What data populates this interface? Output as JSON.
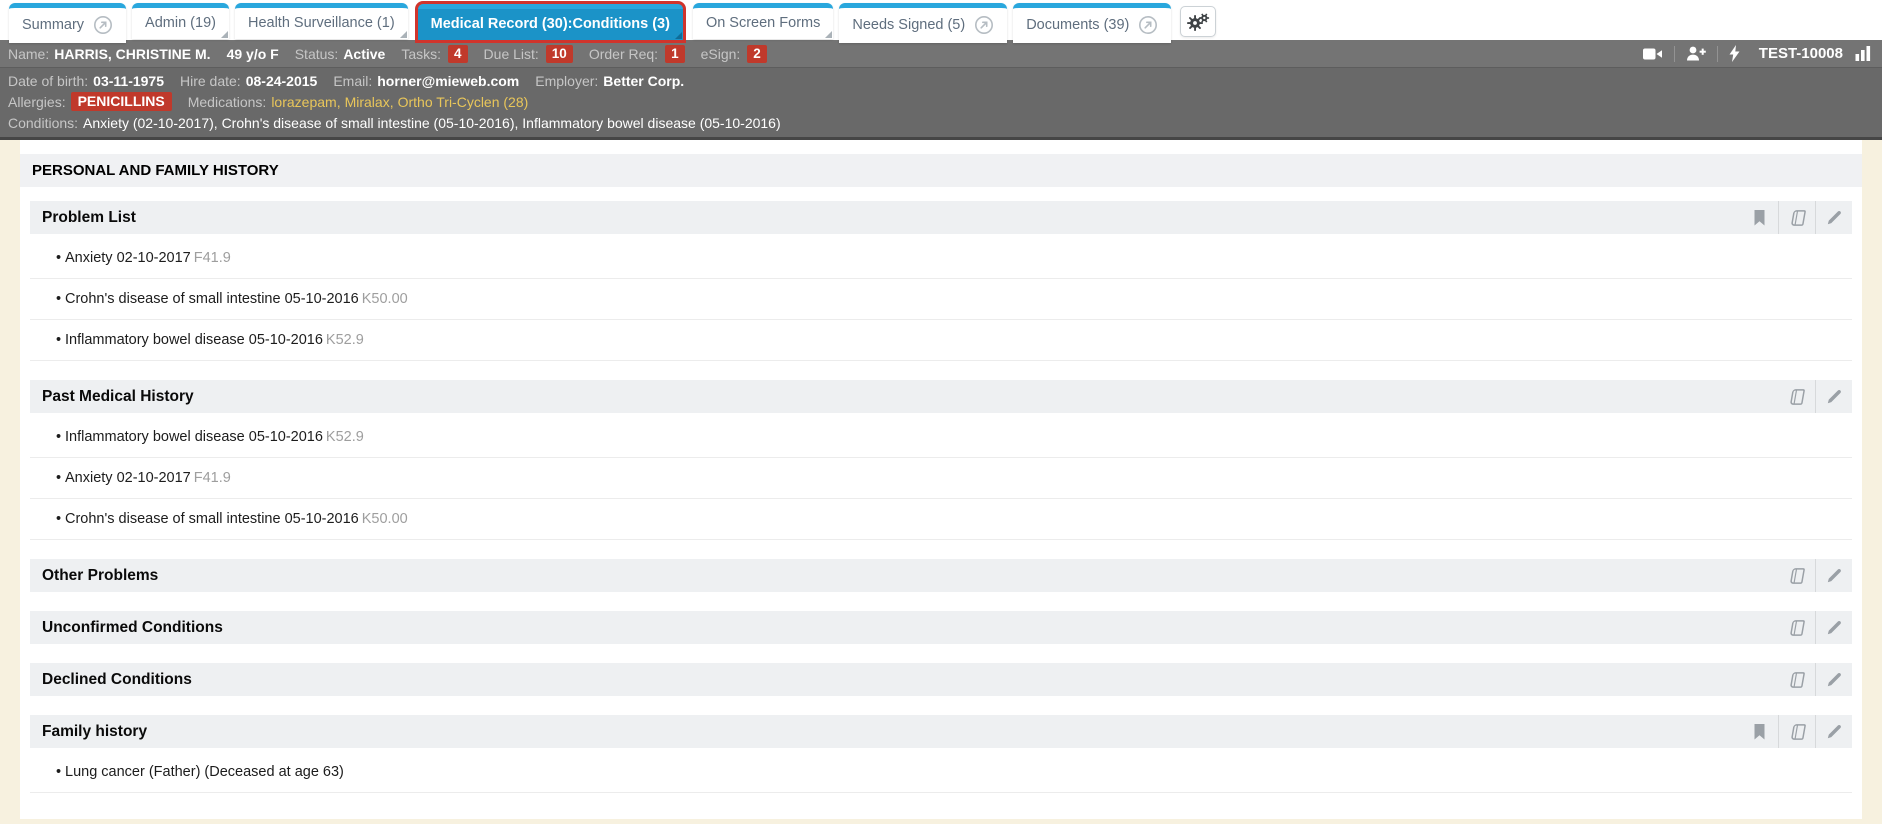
{
  "app": {
    "tabs": [
      {
        "label": "Summary",
        "selected": false,
        "external": true,
        "dropdown": false
      },
      {
        "label": "Admin (19)",
        "selected": false,
        "external": false,
        "dropdown": true
      },
      {
        "label": "Health Surveillance (1)",
        "selected": false,
        "external": false,
        "dropdown": true
      },
      {
        "label": "Medical Record (30):Conditions (3)",
        "selected": true,
        "external": false,
        "dropdown": true
      },
      {
        "label": "On Screen Forms",
        "selected": false,
        "external": false,
        "dropdown": true
      },
      {
        "label": "Needs Signed (5)",
        "selected": false,
        "external": true,
        "dropdown": false
      },
      {
        "label": "Documents (39)",
        "selected": false,
        "external": true,
        "dropdown": false
      }
    ]
  },
  "patient_bar": {
    "row1": {
      "name_label": "Name:",
      "name": "HARRIS, CHRISTINE M.",
      "age_sex": "49 y/o F",
      "status_label": "Status:",
      "status": "Active",
      "badges": [
        {
          "label": "Tasks:",
          "count": "4"
        },
        {
          "label": "Due List:",
          "count": "10"
        },
        {
          "label": "Order Req:",
          "count": "1"
        },
        {
          "label": "eSign:",
          "count": "2"
        }
      ],
      "patient_id": "TEST-10008"
    },
    "row2": [
      {
        "label": "Date of birth:",
        "value": "03-11-1975"
      },
      {
        "label": "Hire date:",
        "value": "08-24-2015"
      },
      {
        "label": "Email:",
        "value": "horner@mieweb.com"
      },
      {
        "label": "Employer:",
        "value": "Better Corp."
      }
    ],
    "row3": {
      "allergies_label": "Allergies:",
      "allergy_badge": "PENICILLINS",
      "medications_label": "Medications:",
      "medications": [
        "lorazepam",
        "Miralax",
        "Ortho Tri-Cyclen (28)"
      ]
    },
    "row4": {
      "label": "Conditions:",
      "value": "Anxiety (02-10-2017), Crohn's disease of small intestine (05-10-2016), Inflammatory bowel disease (05-10-2016)"
    }
  },
  "main": {
    "page_title": "PERSONAL AND FAMILY HISTORY",
    "sections": [
      {
        "title": "Problem List",
        "icons": [
          "bookmark",
          "book",
          "pencil"
        ],
        "items": [
          {
            "text": "Anxiety 02-10-2017",
            "code": "F41.9"
          },
          {
            "text": "Crohn's disease of small intestine 05-10-2016",
            "code": "K50.00"
          },
          {
            "text": "Inflammatory bowel disease 05-10-2016",
            "code": "K52.9"
          }
        ]
      },
      {
        "title": "Past Medical History",
        "icons": [
          "book",
          "pencil"
        ],
        "items": [
          {
            "text": "Inflammatory bowel disease 05-10-2016",
            "code": "K52.9"
          },
          {
            "text": "Anxiety 02-10-2017",
            "code": "F41.9"
          },
          {
            "text": "Crohn's disease of small intestine 05-10-2016",
            "code": "K50.00"
          }
        ]
      },
      {
        "title": "Other Problems",
        "icons": [
          "book",
          "pencil"
        ],
        "items": []
      },
      {
        "title": "Unconfirmed Conditions",
        "icons": [
          "book",
          "pencil"
        ],
        "items": []
      },
      {
        "title": "Declined Conditions",
        "icons": [
          "book",
          "pencil"
        ],
        "items": []
      },
      {
        "title": "Family history",
        "icons": [
          "bookmark",
          "book",
          "pencil"
        ],
        "items": [
          {
            "text": "Lung cancer (Father) (Deceased at age 63)",
            "code": ""
          }
        ]
      }
    ]
  },
  "colors": {
    "accent_blue": "#29a7dd",
    "selected_tab_blue": "#1b93c8",
    "alert_red": "#c0392b",
    "medication_yellow": "#e9c65a",
    "header_gray": "#747474",
    "subheader_gray": "#696969"
  }
}
